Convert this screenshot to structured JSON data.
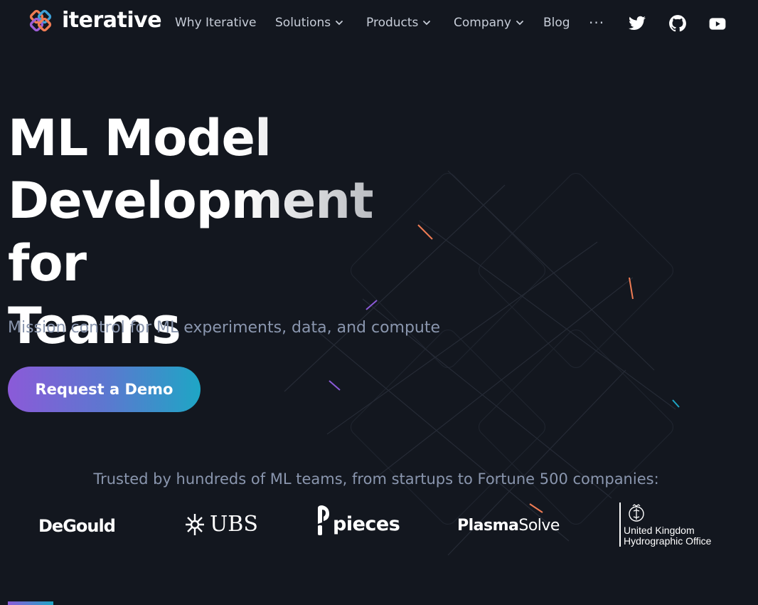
{
  "nav": {
    "brand": "iterative",
    "links": [
      {
        "label": "Why Iterative",
        "dropdown": false
      },
      {
        "label": "Solutions",
        "dropdown": true
      },
      {
        "label": "Products",
        "dropdown": true
      },
      {
        "label": "Company",
        "dropdown": true
      },
      {
        "label": "Blog",
        "dropdown": false
      }
    ],
    "more": "···",
    "social": [
      "twitter-icon",
      "github-icon",
      "youtube-icon"
    ]
  },
  "hero": {
    "title_line1": "ML Model",
    "title_line2": "Development for",
    "title_line3": "Teams",
    "subtitle": "Mission control for ML experiments, data, and compute",
    "cta_label": "Request a Demo"
  },
  "trusted": {
    "heading": "Trusted by hundreds of ML teams, from startups to Fortune 500 companies:",
    "logos": {
      "degould": "DeGould",
      "ubs": "UBS",
      "pieces": "pieces",
      "plasma_bold": "Plasma",
      "plasma_light": "Solve",
      "ukho_line1": "United Kingdom",
      "ukho_line2": "Hydrographic Office"
    }
  },
  "colors": {
    "background": "#13171f",
    "nav_text": "#c7cdd8",
    "muted_text": "#8a96ae",
    "gradient_start": "#8b5ad8",
    "gradient_end": "#1ea6c5",
    "logo_orange": "#ef7c54",
    "logo_purple": "#9d5ed6",
    "logo_blue": "#3ea0d6"
  }
}
